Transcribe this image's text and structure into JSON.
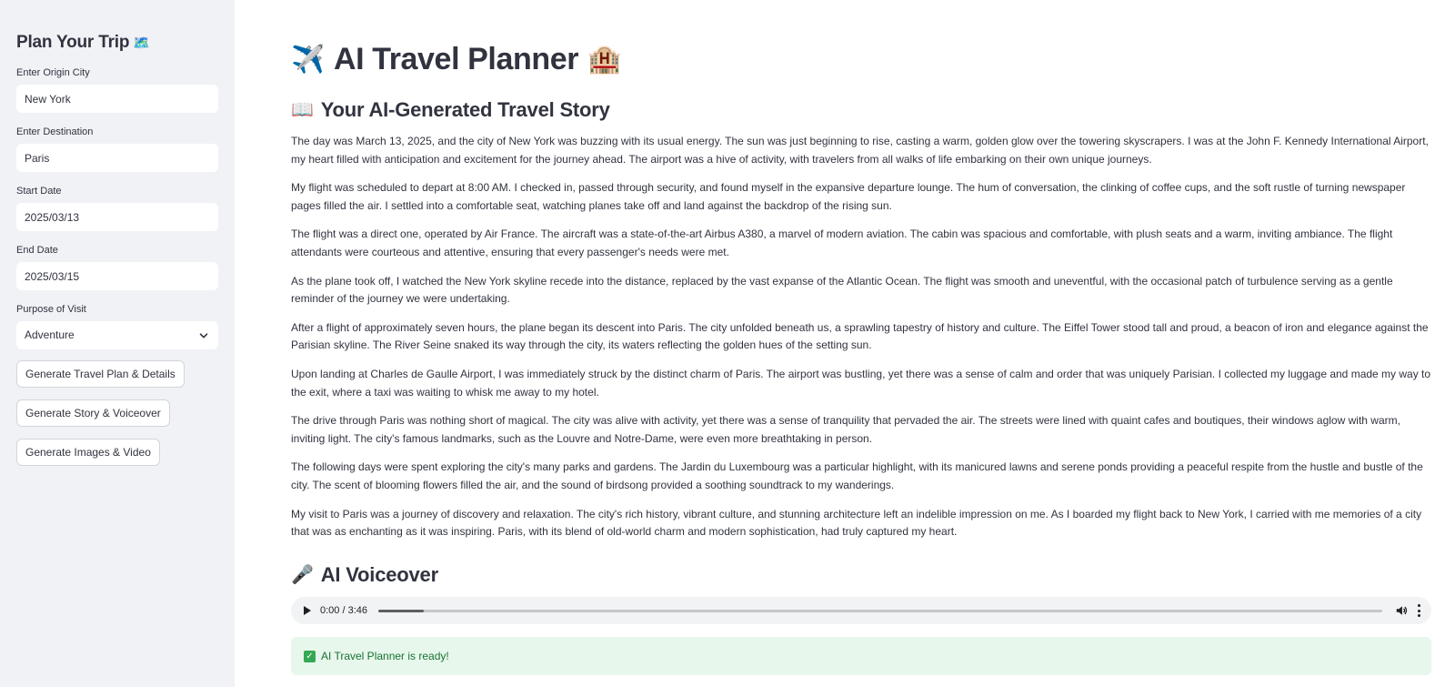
{
  "sidebar": {
    "title": "Plan Your Trip",
    "title_icon": "world-map-icon",
    "origin": {
      "label": "Enter Origin City",
      "value": "New York"
    },
    "destination": {
      "label": "Enter Destination",
      "value": "Paris"
    },
    "start_date": {
      "label": "Start Date",
      "value": "2025/03/13"
    },
    "end_date": {
      "label": "End Date",
      "value": "2025/03/15"
    },
    "purpose": {
      "label": "Purpose of Visit",
      "value": "Adventure"
    },
    "buttons": {
      "plan": "Generate Travel Plan & Details",
      "story": "Generate Story & Voiceover",
      "images": "Generate Images & Video"
    }
  },
  "main": {
    "title": "AI Travel Planner",
    "title_icons": [
      "airplane-icon",
      "hotel-icon"
    ],
    "story_heading": "Your AI-Generated Travel Story",
    "story_icon": "open-book-icon",
    "story_paragraphs": [
      "The day was March 13, 2025, and the city of New York was buzzing with its usual energy. The sun was just beginning to rise, casting a warm, golden glow over the towering skyscrapers. I was at the John F. Kennedy International Airport, my heart filled with anticipation and excitement for the journey ahead. The airport was a hive of activity, with travelers from all walks of life embarking on their own unique journeys.",
      "My flight was scheduled to depart at 8:00 AM. I checked in, passed through security, and found myself in the expansive departure lounge. The hum of conversation, the clinking of coffee cups, and the soft rustle of turning newspaper pages filled the air. I settled into a comfortable seat, watching planes take off and land against the backdrop of the rising sun.",
      "The flight was a direct one, operated by Air France. The aircraft was a state-of-the-art Airbus A380, a marvel of modern aviation. The cabin was spacious and comfortable, with plush seats and a warm, inviting ambiance. The flight attendants were courteous and attentive, ensuring that every passenger's needs were met.",
      "As the plane took off, I watched the New York skyline recede into the distance, replaced by the vast expanse of the Atlantic Ocean. The flight was smooth and uneventful, with the occasional patch of turbulence serving as a gentle reminder of the journey we were undertaking.",
      "After a flight of approximately seven hours, the plane began its descent into Paris. The city unfolded beneath us, a sprawling tapestry of history and culture. The Eiffel Tower stood tall and proud, a beacon of iron and elegance against the Parisian skyline. The River Seine snaked its way through the city, its waters reflecting the golden hues of the setting sun.",
      "Upon landing at Charles de Gaulle Airport, I was immediately struck by the distinct charm of Paris. The airport was bustling, yet there was a sense of calm and order that was uniquely Parisian. I collected my luggage and made my way to the exit, where a taxi was waiting to whisk me away to my hotel.",
      "The drive through Paris was nothing short of magical. The city was alive with activity, yet there was a sense of tranquility that pervaded the air. The streets were lined with quaint cafes and boutiques, their windows aglow with warm, inviting light. The city's famous landmarks, such as the Louvre and Notre-Dame, were even more breathtaking in person.",
      "The following days were spent exploring the city's many parks and gardens. The Jardin du Luxembourg was a particular highlight, with its manicured lawns and serene ponds providing a peaceful respite from the hustle and bustle of the city. The scent of blooming flowers filled the air, and the sound of birdsong provided a soothing soundtrack to my wanderings.",
      "My visit to Paris was a journey of discovery and relaxation. The city's rich history, vibrant culture, and stunning architecture left an indelible impression on me. As I boarded my flight back to New York, I carried with me memories of a city that was as enchanting as it was inspiring. Paris, with its blend of old-world charm and modern sophistication, had truly captured my heart."
    ],
    "voiceover_heading": "AI Voiceover",
    "voiceover_icon": "microphone-icon",
    "audio": {
      "time": "0:00 / 3:46",
      "progress": 0.045
    },
    "status": "AI Travel Planner is ready!"
  },
  "colors": {
    "sidebar_bg": "#f0f2f6",
    "success_bg": "#e8f7ec",
    "success_text": "#177233",
    "text": "#31333f"
  }
}
